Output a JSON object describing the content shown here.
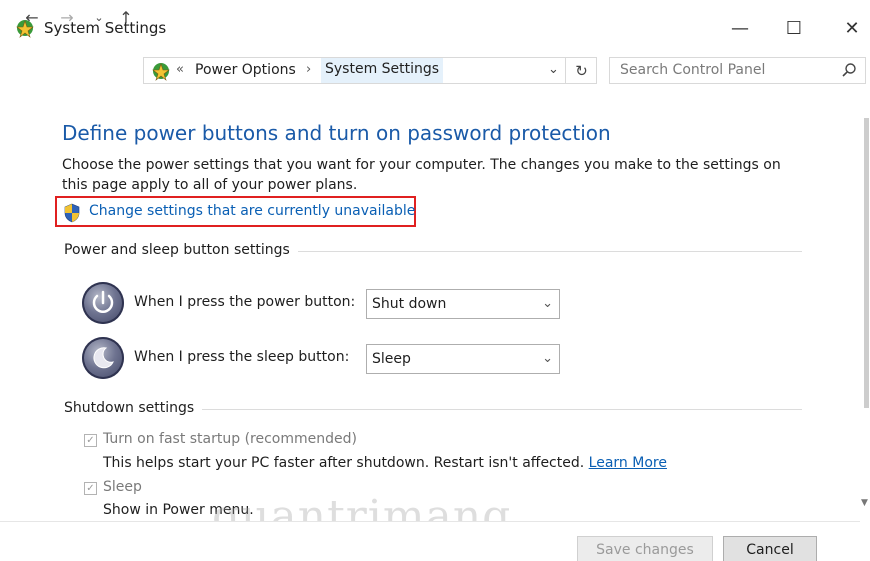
{
  "window": {
    "title": "System Settings",
    "controls": {
      "minimize": "—",
      "maximize": "☐",
      "close": "✕"
    }
  },
  "nav": {
    "back": "←",
    "forward": "→",
    "recent": "⌄",
    "up": "↑",
    "overflow": "«",
    "breadcrumb": [
      "Power Options",
      "System Settings"
    ],
    "separator": "›",
    "dropdown": "⌄",
    "refresh": "↻",
    "search_placeholder": "Search Control Panel"
  },
  "main": {
    "title": "Define power buttons and turn on password protection",
    "description": "Choose the power settings that you want for your computer. The changes you make to the settings on this page apply to all of your power plans.",
    "change_link": "Change settings that are currently unavailable",
    "power_sleep_group": {
      "title": "Power and sleep button settings",
      "power_button_label": "When I press the power button:",
      "power_button_value": "Shut down",
      "sleep_button_label": "When I press the sleep button:",
      "sleep_button_value": "Sleep"
    },
    "shutdown_group": {
      "title": "Shutdown settings",
      "fast_startup_label": "Turn on fast startup (recommended)",
      "fast_startup_checked": true,
      "fast_startup_desc": "This helps start your PC faster after shutdown. Restart isn't affected.",
      "learn_more": "Learn More",
      "sleep_label": "Sleep",
      "sleep_checked": true,
      "sleep_desc": "Show in Power menu."
    }
  },
  "footer": {
    "save": "Save changes",
    "cancel": "Cancel"
  },
  "watermark": "quantrimang",
  "colors": {
    "title_blue": "#1a5aa8",
    "link_blue": "#0a5fb4",
    "highlight_red": "#e02020"
  }
}
